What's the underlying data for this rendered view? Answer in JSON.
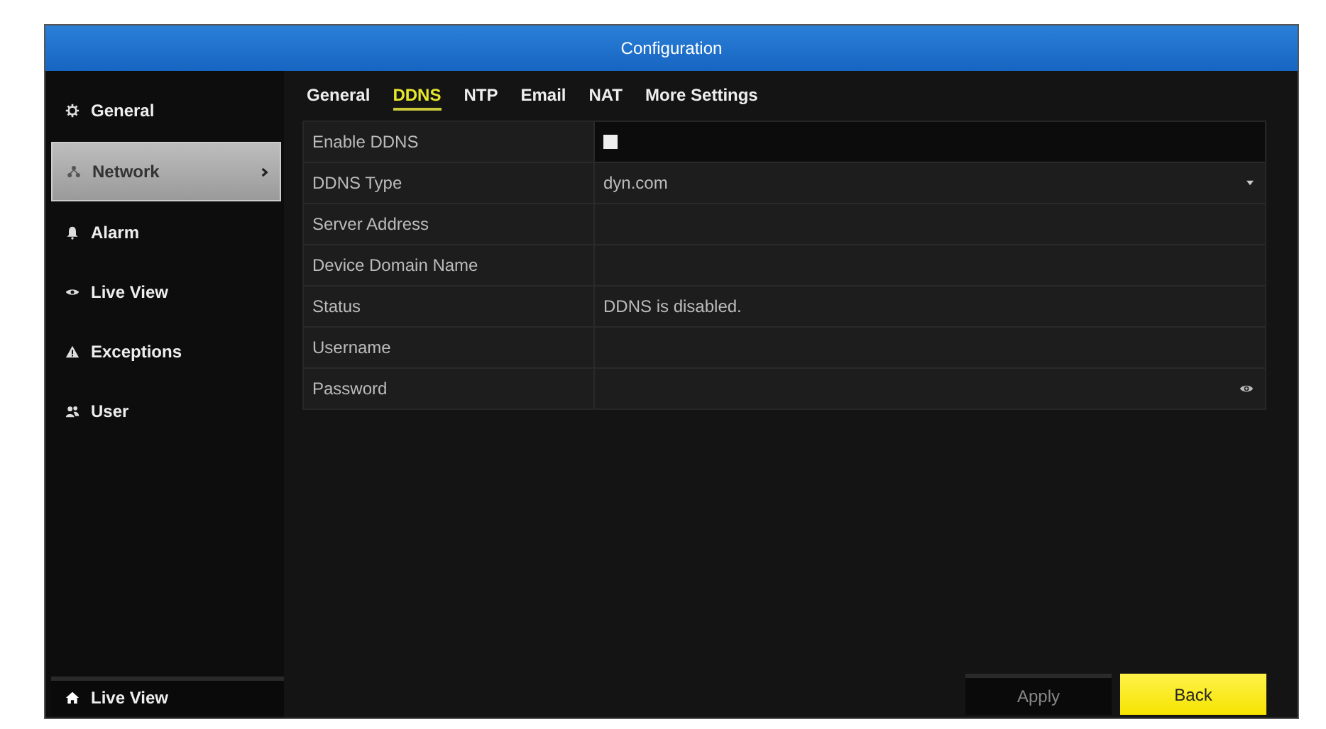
{
  "window": {
    "title": "Configuration"
  },
  "sidebar": {
    "items": [
      {
        "label": "General",
        "kind": "gear",
        "selected": false
      },
      {
        "label": "Network",
        "kind": "network",
        "selected": true
      },
      {
        "label": "Alarm",
        "kind": "bell",
        "selected": false
      },
      {
        "label": "Live View",
        "kind": "eye",
        "selected": false
      },
      {
        "label": "Exceptions",
        "kind": "warning",
        "selected": false
      },
      {
        "label": "User",
        "kind": "users",
        "selected": false
      }
    ],
    "footer": {
      "label": "Live View"
    }
  },
  "tabs": [
    {
      "label": "General",
      "selected": false
    },
    {
      "label": "DDNS",
      "selected": true
    },
    {
      "label": "NTP",
      "selected": false
    },
    {
      "label": "Email",
      "selected": false
    },
    {
      "label": "NAT",
      "selected": false
    },
    {
      "label": "More Settings",
      "selected": false
    }
  ],
  "form": [
    {
      "label": "Enable DDNS",
      "kind": "checkbox",
      "checked": false
    },
    {
      "label": "DDNS Type",
      "kind": "dropdown",
      "value": "dyn.com"
    },
    {
      "label": "Server Address",
      "kind": "text"
    },
    {
      "label": "Device Domain Name",
      "kind": "text"
    },
    {
      "label": "Status",
      "kind": "text",
      "value": "DDNS is disabled."
    },
    {
      "label": "Username",
      "kind": "text"
    },
    {
      "label": "Password",
      "kind": "password"
    }
  ],
  "buttons": [
    {
      "label": "Apply",
      "kind": "secondary"
    },
    {
      "label": "Back",
      "kind": "primary"
    }
  ]
}
